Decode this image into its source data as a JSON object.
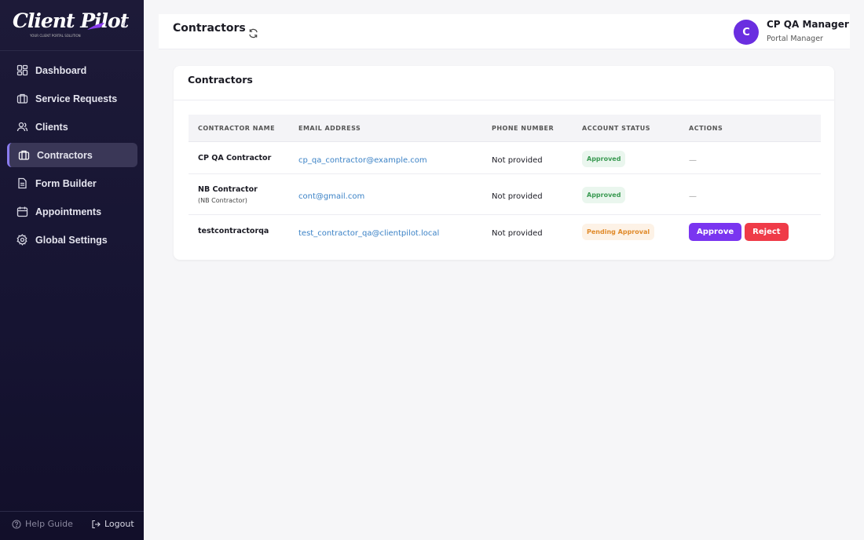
{
  "brand": {
    "name": "Client Pilot",
    "tagline": "YOUR CLIENT PORTAL SOLUTION"
  },
  "nav": {
    "items": [
      {
        "label": "Dashboard",
        "icon": "grid-icon"
      },
      {
        "label": "Service Requests",
        "icon": "briefcase-icon"
      },
      {
        "label": "Clients",
        "icon": "users-icon"
      },
      {
        "label": "Contractors",
        "icon": "briefcase-icon",
        "active": true
      },
      {
        "label": "Form Builder",
        "icon": "file-icon"
      },
      {
        "label": "Appointments",
        "icon": "calendar-icon"
      },
      {
        "label": "Global Settings",
        "icon": "gear-icon"
      }
    ],
    "help_label": "Help Guide",
    "logout_label": "Logout"
  },
  "header": {
    "title": "Contractors",
    "user": {
      "initial": "C",
      "name": "CP QA Manager",
      "role": "Portal Manager"
    }
  },
  "card": {
    "title": "Contractors",
    "columns": [
      "Contractor Name",
      "Email Address",
      "Phone Number",
      "Account Status",
      "Actions"
    ],
    "rows": [
      {
        "name": "CP QA Contractor",
        "sub": "",
        "email": "cp_qa_contractor@example.com",
        "phone": "Not provided",
        "status": "Approved",
        "actions": "—"
      },
      {
        "name": "NB Contractor",
        "sub": "(NB Contractor)",
        "email": "cont@gmail.com",
        "phone": "Not provided",
        "status": "Approved",
        "actions": "—"
      },
      {
        "name": "testcontractorqa",
        "sub": "",
        "email": "test_contractor_qa@clientpilot.local",
        "phone": "Not provided",
        "status": "Pending Approval",
        "approve_label": "Approve",
        "reject_label": "Reject"
      }
    ]
  },
  "colors": {
    "accent": "#7a35f0",
    "reject": "#ef3b48",
    "approved": "#3a9a52",
    "pending": "#e08a2a",
    "sidebar": "#1d1a38"
  }
}
